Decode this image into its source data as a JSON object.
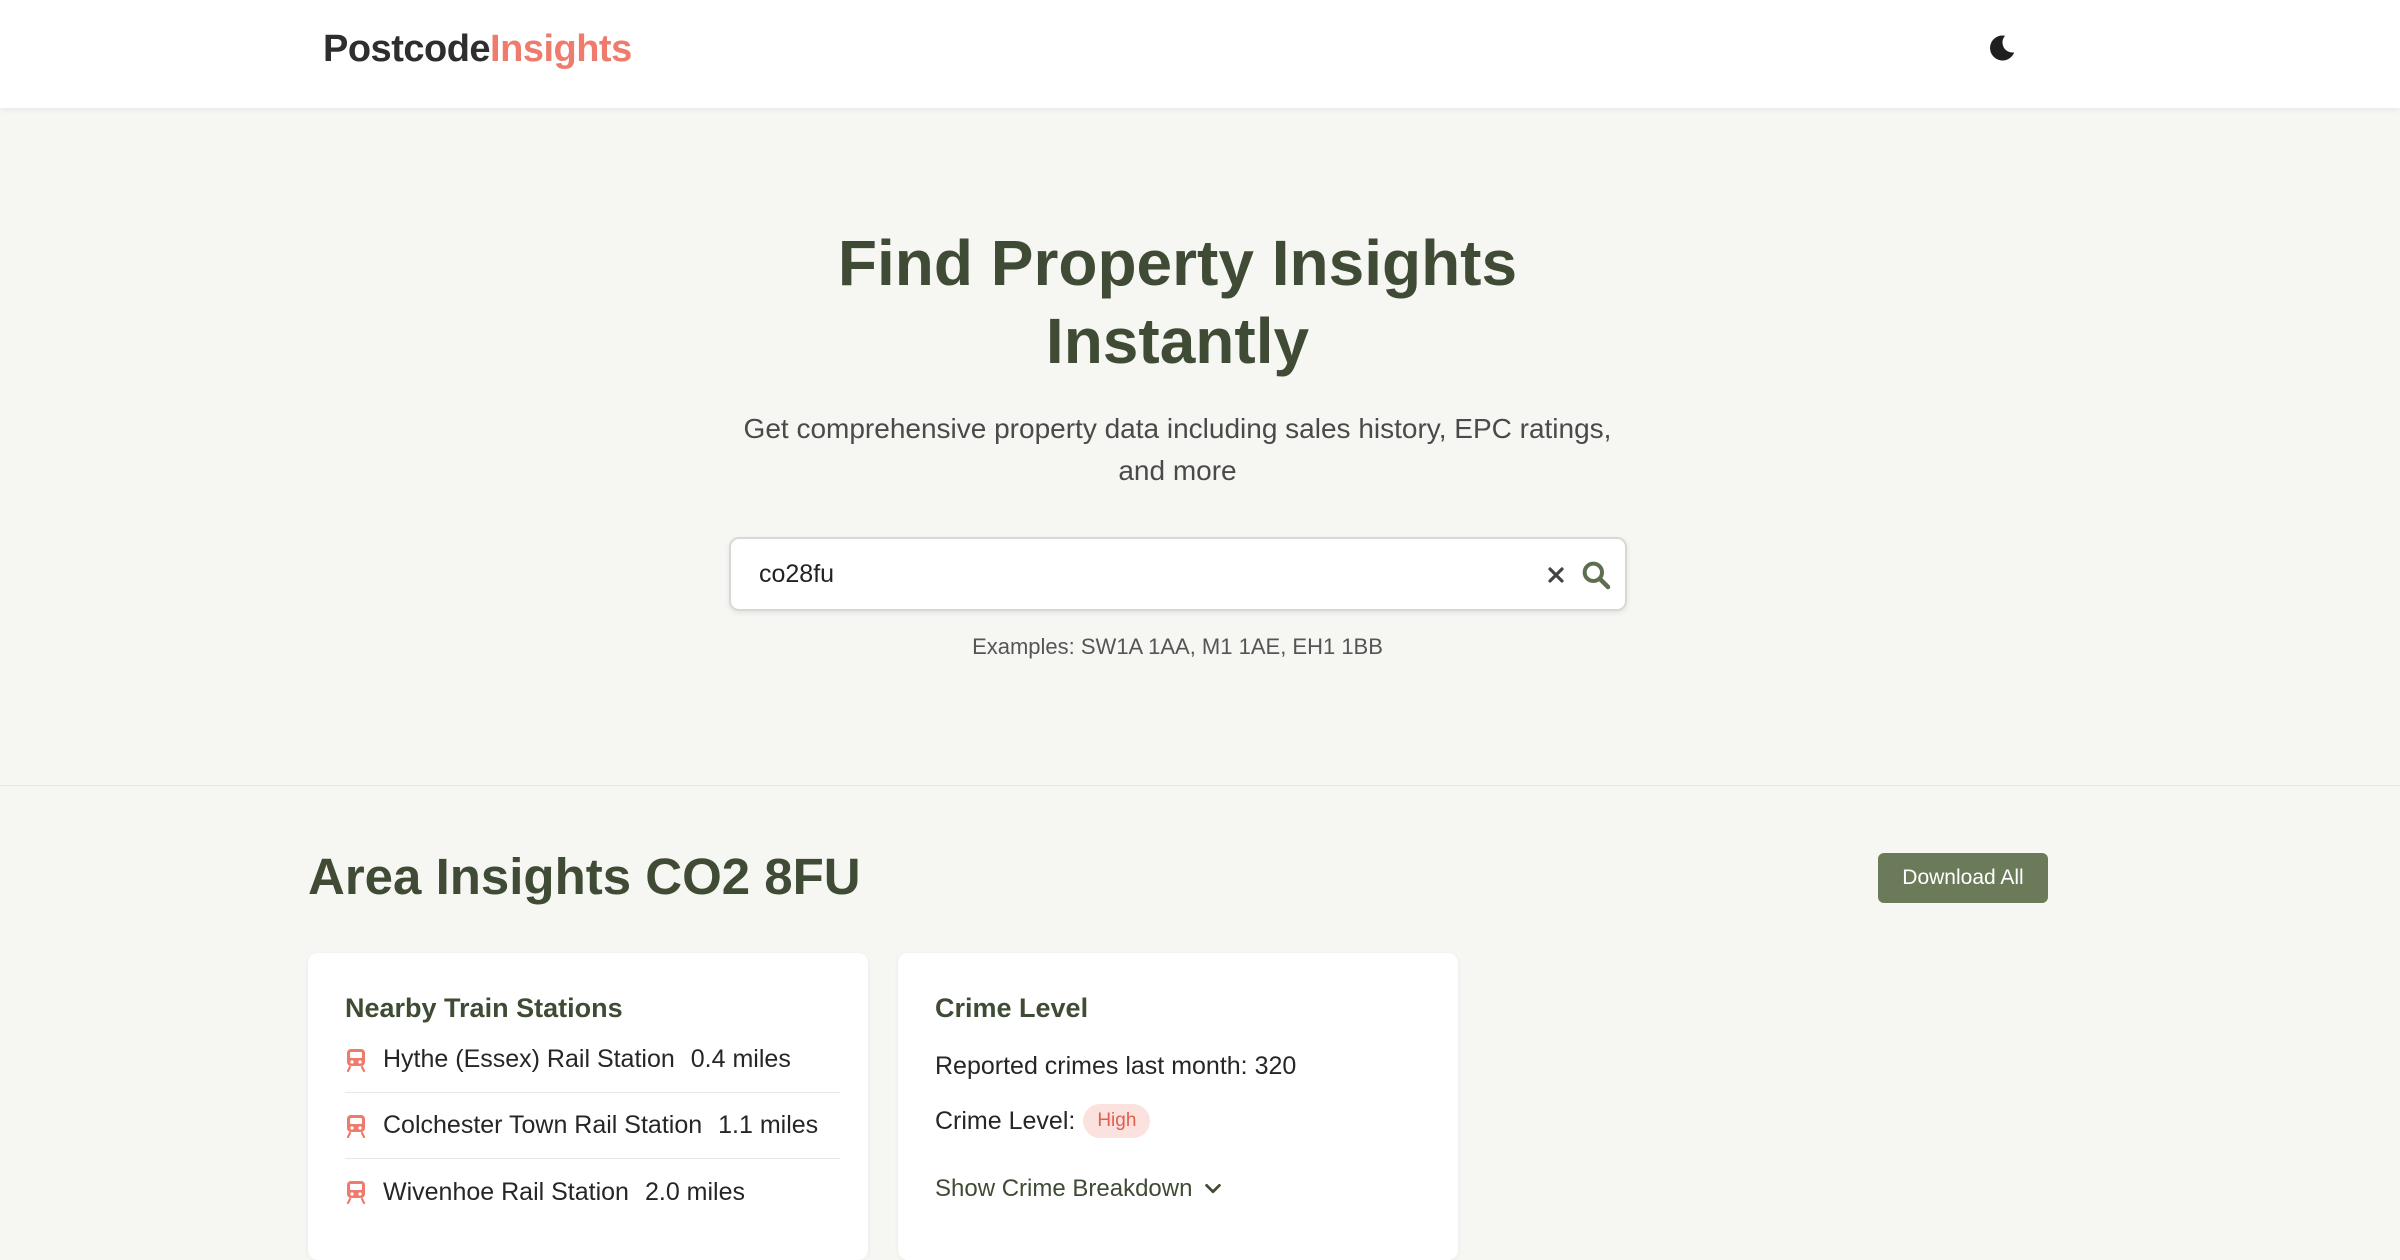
{
  "header": {
    "logo_part1": "Postcode",
    "logo_part2": "Insights",
    "theme_toggle_icon": "moon-icon"
  },
  "hero": {
    "title_line1": "Find Property Insights",
    "title_line2": "Instantly",
    "subtitle_line1": "Get comprehensive property data including sales history, EPC ratings,",
    "subtitle_line2": "and more"
  },
  "search": {
    "value": "co28fu",
    "clear_icon": "close-icon",
    "search_icon": "search-icon",
    "examples": "Examples: SW1A 1AA, M1 1AE, EH1 1BB"
  },
  "area": {
    "title": "Area Insights CO2 8FU",
    "download_label": "Download All"
  },
  "train_card": {
    "title": "Nearby Train Stations",
    "icon": "train-icon",
    "stations": [
      {
        "name": "Hythe (Essex) Rail Station",
        "distance": "0.4 miles"
      },
      {
        "name": "Colchester Town Rail Station",
        "distance": "1.1 miles"
      },
      {
        "name": "Wivenhoe Rail Station",
        "distance": "2.0 miles"
      }
    ]
  },
  "crime_card": {
    "title": "Crime Level",
    "reported_line": "Reported crimes last month: 320",
    "level_label": "Crime Level:",
    "level_value": "High",
    "breakdown_label": "Show Crime Breakdown",
    "breakdown_icon": "chevron-down-icon"
  },
  "colors": {
    "accent_green": "#3f4b35",
    "button_green": "#6b7b5a",
    "brand_coral": "#ee7b6c",
    "badge_bg": "#fbe2de",
    "badge_text": "#e25d4d",
    "page_bg": "#f6f6f3"
  }
}
